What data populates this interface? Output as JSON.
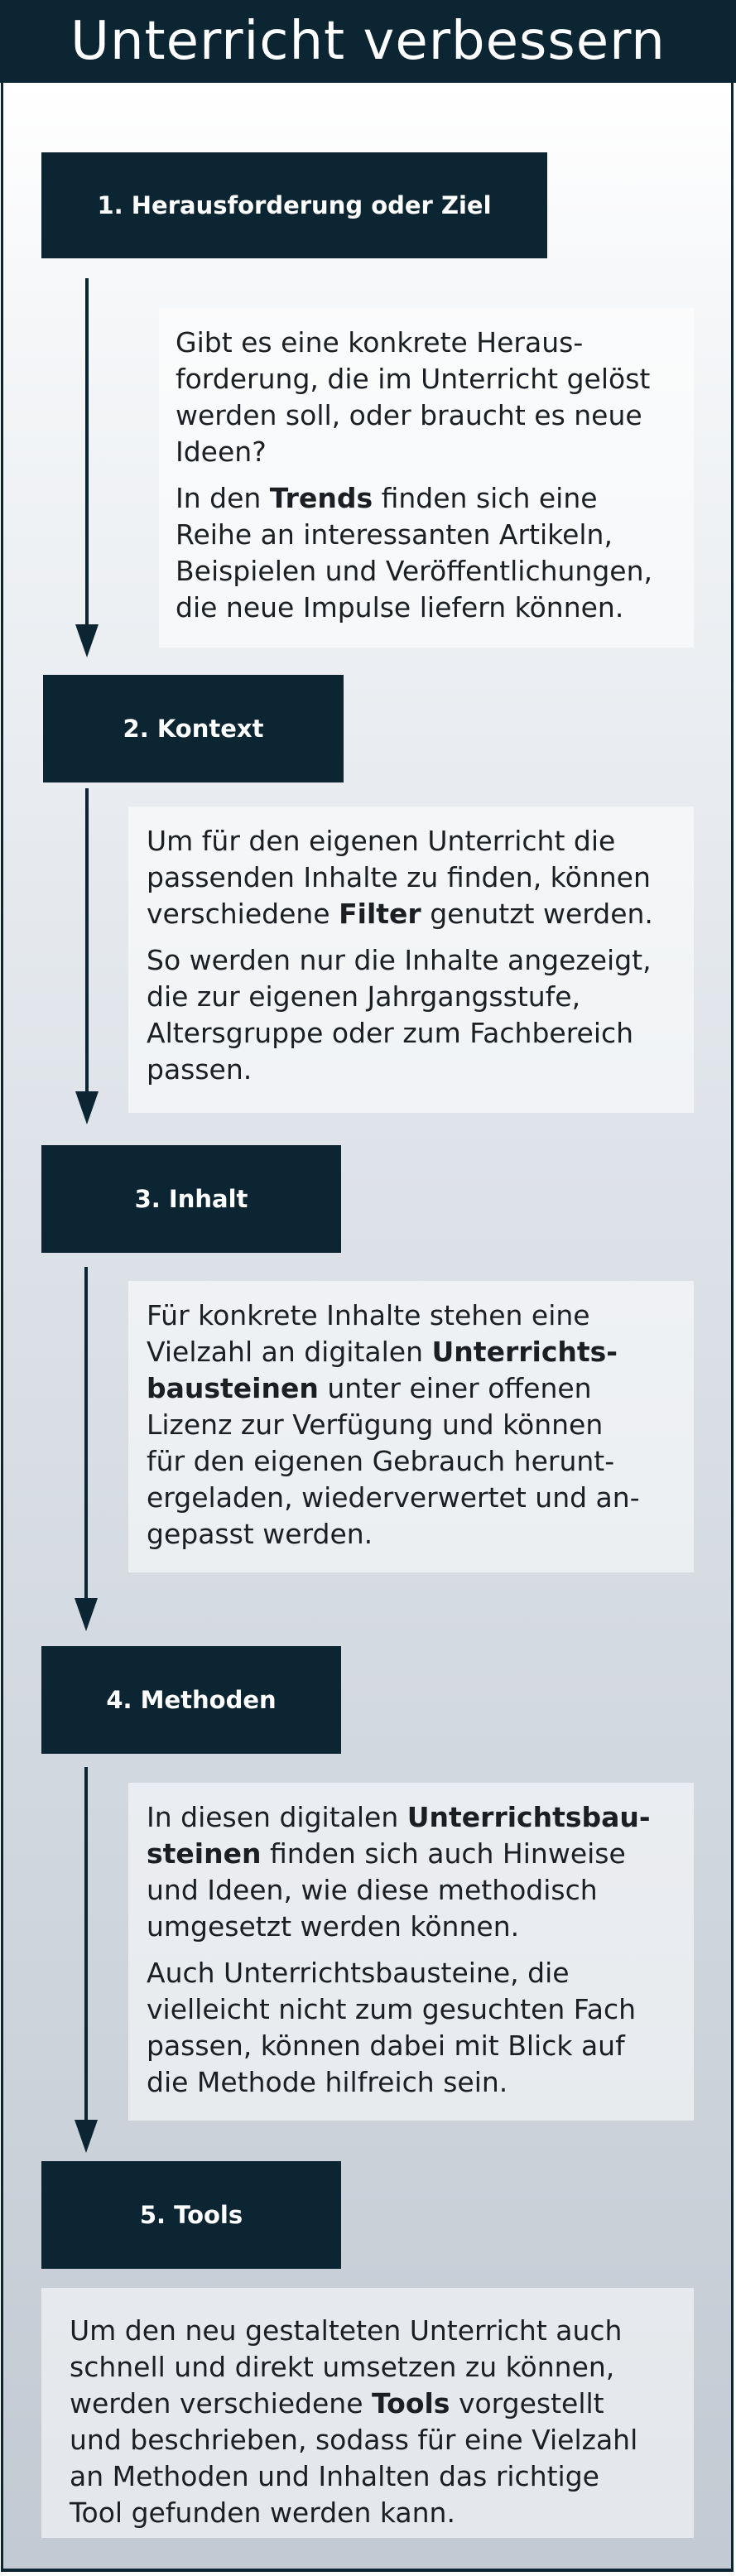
{
  "title": "Unterricht verbessern",
  "steps": [
    {
      "label": "1. Herausforderung oder Ziel",
      "paragraphs": [
        [
          {
            "t": "Gibt es eine konkrete Heraus-\nforderung, die im Unterricht gelöst\nwerden soll, oder braucht es neue\nIdeen?"
          }
        ],
        [
          {
            "t": "In den "
          },
          {
            "t": "Trends",
            "b": true
          },
          {
            "t": " finden sich eine\nReihe an interessanten Artikeln,\nBeispielen und Veröffentlichungen,\ndie neue Impulse liefern können."
          }
        ]
      ]
    },
    {
      "label": "2. Kontext",
      "paragraphs": [
        [
          {
            "t": "Um für den eigenen Unterricht die\npassenden Inhalte zu finden, können\nverschiedene "
          },
          {
            "t": "Filter",
            "b": true
          },
          {
            "t": " genutzt werden."
          }
        ],
        [
          {
            "t": "So werden nur die Inhalte angezeigt,\ndie zur eigenen Jahrgangsstufe,\nAltersgruppe oder zum Fachbereich\npassen."
          }
        ]
      ]
    },
    {
      "label": "3. Inhalt",
      "paragraphs": [
        [
          {
            "t": "Für konkrete Inhalte stehen eine\nVielzahl an digitalen "
          },
          {
            "t": "Unterrichts-\nbausteinen",
            "b": true
          },
          {
            "t": " unter einer offenen\nLizenz zur Verfügung und können\nfür den eigenen Gebrauch herunt-\nergeladen, wiederverwertet und an-\ngepasst werden."
          }
        ]
      ]
    },
    {
      "label": "4. Methoden",
      "paragraphs": [
        [
          {
            "t": "In diesen digitalen "
          },
          {
            "t": "Unterrichtsbau-\nsteinen",
            "b": true
          },
          {
            "t": " finden sich auch Hinweise\nund Ideen, wie diese methodisch\numgesetzt werden können."
          }
        ],
        [
          {
            "t": "Auch Unterrichtsbausteine, die\nvielleicht nicht zum gesuchten Fach\npassen, können dabei mit Blick auf\ndie Methode hilfreich sein."
          }
        ]
      ]
    },
    {
      "label": "5. Tools",
      "paragraphs": [
        [
          {
            "t": "Um den neu gestalteten Unterricht auch\nschnell und direkt umsetzen zu können,\nwerden verschiedene "
          },
          {
            "t": "Tools",
            "b": true
          },
          {
            "t": " vorgestellt\nund beschrieben, sodass für eine Vielzahl\nan Methoden und Inhalten das richtige\nTool gefunden werden kann."
          }
        ]
      ]
    }
  ]
}
